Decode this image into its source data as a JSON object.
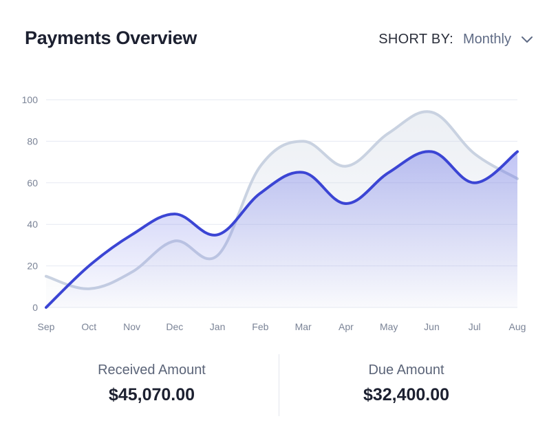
{
  "header": {
    "title": "Payments Overview",
    "sort_label": "SHORT BY:",
    "sort_value": "Monthly"
  },
  "colors": {
    "received": "#3b45d4",
    "due": "#c9d2e1",
    "grid": "#e6e9f2",
    "tick": "#7a8396"
  },
  "chart_data": {
    "type": "area",
    "categories": [
      "Sep",
      "Oct",
      "Nov",
      "Dec",
      "Jan",
      "Feb",
      "Mar",
      "Apr",
      "May",
      "Jun",
      "Jul",
      "Aug"
    ],
    "ylim": [
      0,
      100
    ],
    "yticks": [
      0,
      20,
      40,
      60,
      80,
      100
    ],
    "grid": true,
    "series": [
      {
        "values": [
          0,
          20,
          35,
          45,
          35,
          55,
          65,
          50,
          65,
          75,
          60,
          75
        ]
      },
      {
        "values": [
          15,
          9,
          17,
          32,
          25,
          68,
          80,
          68,
          84,
          94,
          74,
          62
        ]
      }
    ]
  },
  "summary": {
    "received_label": "Received Amount",
    "received_value": "$45,070.00",
    "due_label": "Due Amount",
    "due_value": "$32,400.00"
  }
}
